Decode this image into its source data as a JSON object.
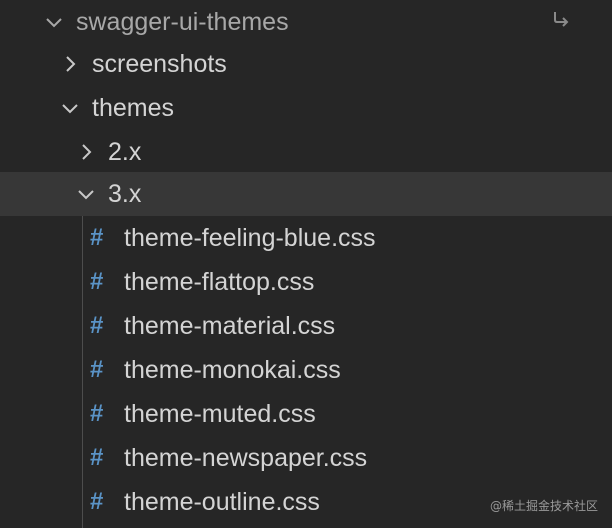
{
  "explorer": {
    "root": {
      "label": "swagger-ui-themes",
      "expanded": true
    },
    "folders": [
      {
        "label": "screenshots",
        "expanded": false
      },
      {
        "label": "themes",
        "expanded": true
      },
      {
        "label": "2.x",
        "expanded": false
      },
      {
        "label": "3.x",
        "expanded": true,
        "selected": true
      }
    ],
    "file_icon_glyph": "#",
    "files": [
      {
        "label": "theme-feeling-blue.css"
      },
      {
        "label": "theme-flattop.css"
      },
      {
        "label": "theme-material.css"
      },
      {
        "label": "theme-monokai.css"
      },
      {
        "label": "theme-muted.css"
      },
      {
        "label": "theme-newspaper.css"
      },
      {
        "label": "theme-outline.css"
      }
    ]
  },
  "watermark": "@稀土掘金技术社区",
  "colors": {
    "background": "#262626",
    "selected_row": "#373737",
    "css_icon": "#5a93c6",
    "text": "#d4d4d4"
  }
}
